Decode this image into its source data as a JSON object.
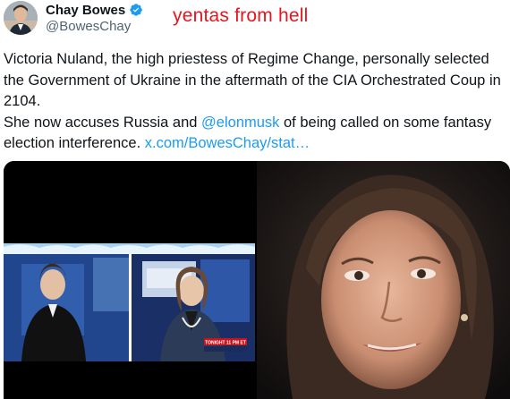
{
  "author": {
    "display_name": "Chay Bowes",
    "handle": "@BowesChay",
    "avatar_icon": "avatar-photo",
    "verified_icon": "verified-badge-icon",
    "verified_color": "#1d9bf0"
  },
  "annotation": {
    "text": "yentas from hell",
    "color": "#e8141e"
  },
  "tweet": {
    "paragraph1": "Victoria Nuland, the high priestess of Regime Change, personally selected the Government of Ukraine in the aftermath of the CIA Orchestrated Coup in 2104.",
    "paragraph2_before": "She now accuses Russia and ",
    "mention": "@elonmusk",
    "paragraph2_after": " of being called on some fantasy election interference.  ",
    "link": "x.com/BowesChay/stat…"
  },
  "media": {
    "left_banner_text": "TONIGHT 11 PM ET",
    "left_label": "MSNBC"
  },
  "colors": {
    "link": "#1d9bf0",
    "text": "#0f1419",
    "secondary_text": "#536471"
  }
}
